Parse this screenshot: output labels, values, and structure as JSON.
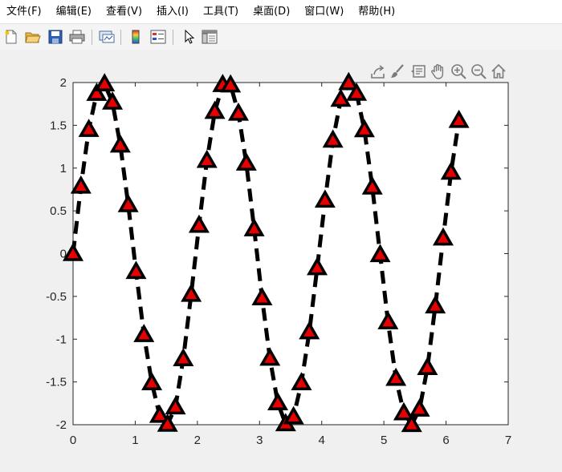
{
  "menu": [
    "文件(F)",
    "编辑(E)",
    "查看(V)",
    "插入(I)",
    "工具(T)",
    "桌面(D)",
    "窗口(W)",
    "帮助(H)"
  ],
  "toolbar": {
    "buttons": [
      "new-figure-icon",
      "open-file-icon",
      "save-icon",
      "print-icon",
      "link-plot-icon",
      "colorbar-icon",
      "legend-icon",
      "edit-plot-pointer-icon",
      "property-inspector-icon"
    ]
  },
  "axes_toolbar": {
    "buttons": [
      "export-icon",
      "brush-icon",
      "data-tip-icon",
      "pan-hand-icon",
      "zoom-in-icon",
      "zoom-out-icon",
      "home-icon"
    ]
  },
  "colors": {
    "line": "#000000",
    "marker_fill": "#e60000",
    "marker_edge": "#000000",
    "axes_bg": "#ffffff",
    "figure_bg": "#f0f0f0"
  },
  "chart_data": {
    "type": "line",
    "title": "",
    "xlabel": "",
    "ylabel": "",
    "xlim": [
      0,
      7
    ],
    "ylim": [
      -2,
      2
    ],
    "xticks": [
      "0",
      "1",
      "2",
      "3",
      "4",
      "5",
      "6",
      "7"
    ],
    "yticks": [
      "-2",
      "-1.5",
      "-1",
      "-0.5",
      "0",
      "0.5",
      "1",
      "1.5",
      "2"
    ],
    "grid": false,
    "line_style": "dashed",
    "marker": "triangle-up",
    "series": [
      {
        "x": [
          0,
          0.1267,
          0.2534,
          0.38,
          0.5067,
          0.6334,
          0.7601,
          0.8867,
          1.0134,
          1.1401,
          1.2668,
          1.3934,
          1.5201,
          1.6468,
          1.7735,
          1.9001,
          2.0268,
          2.1535,
          2.2802,
          2.4068,
          2.5335,
          2.6602,
          2.7869,
          2.9135,
          3.0402,
          3.1669,
          3.2936,
          3.4202,
          3.5469,
          3.6736,
          3.8003,
          3.9269,
          4.0536,
          4.1803,
          4.307,
          4.4336,
          4.5603,
          4.687,
          4.8137,
          4.9403,
          5.067,
          5.1937,
          5.3204,
          5.447,
          5.5737,
          5.7004,
          5.8271,
          5.9537,
          6.0804,
          6.2071
        ],
        "y": [
          0,
          0.788,
          1.451,
          1.872,
          1.984,
          1.77,
          1.268,
          0.572,
          -0.21,
          -0.947,
          -1.511,
          -1.891,
          -1.995,
          -1.793,
          -1.229,
          -0.476,
          0.33,
          1.089,
          1.662,
          1.975,
          1.971,
          1.64,
          1.057,
          0.289,
          -0.517,
          -1.224,
          -1.745,
          -1.99,
          -1.908,
          -1.511,
          -0.914,
          -0.165,
          0.624,
          1.326,
          1.803,
          1.998,
          1.873,
          1.447,
          0.778,
          -0.013,
          -0.797,
          -1.459,
          -1.862,
          -1.999,
          -1.818,
          -1.333,
          -0.612,
          0.181,
          0.951,
          1.556
        ]
      }
    ]
  }
}
